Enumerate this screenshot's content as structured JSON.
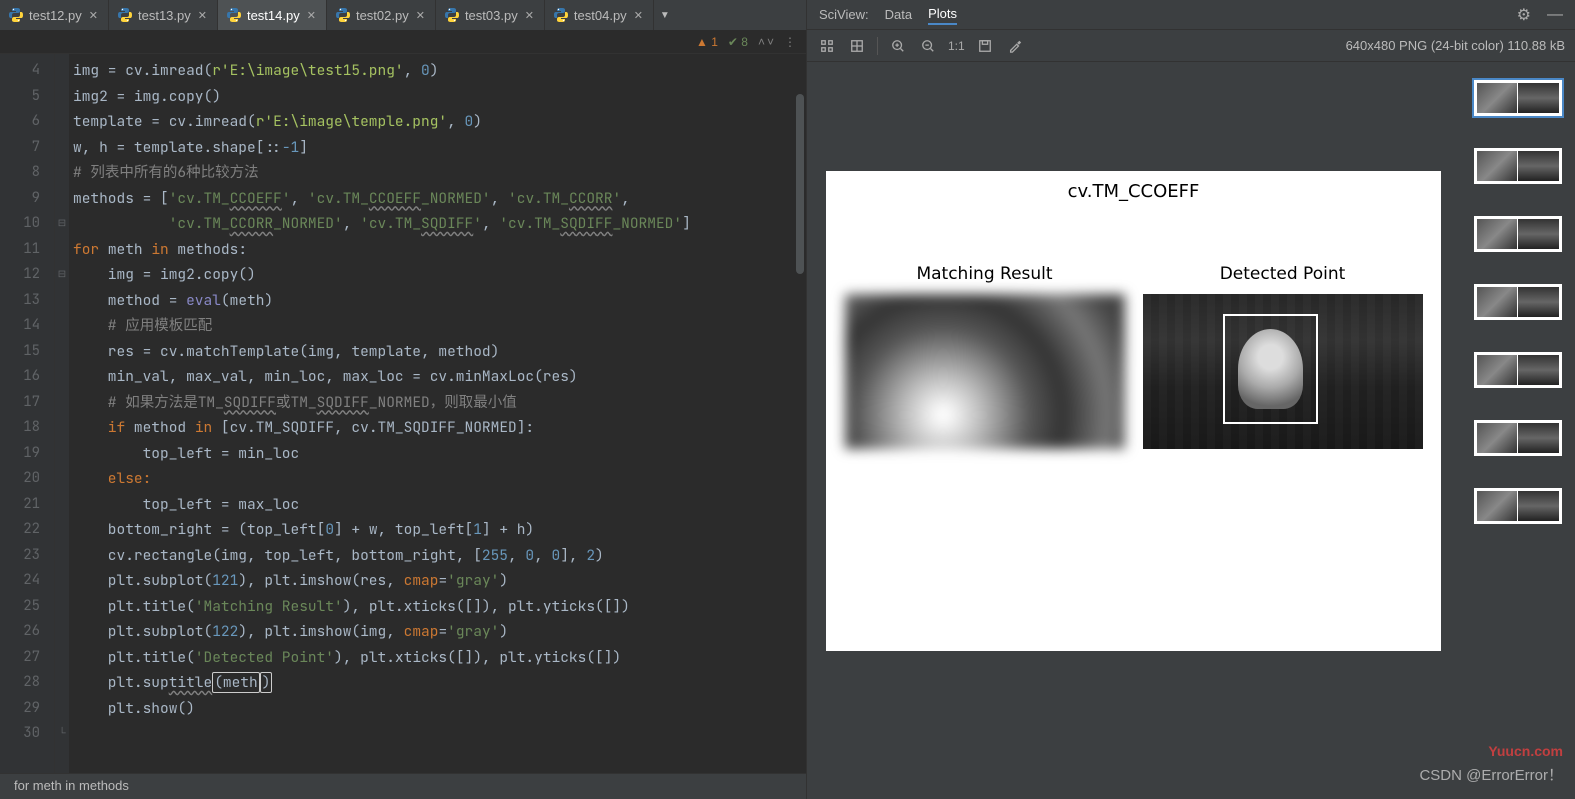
{
  "tabs": [
    {
      "name": "test12.py",
      "active": false
    },
    {
      "name": "test13.py",
      "active": false
    },
    {
      "name": "test14.py",
      "active": true
    },
    {
      "name": "test02.py",
      "active": false
    },
    {
      "name": "test03.py",
      "active": false
    },
    {
      "name": "test04.py",
      "active": false
    }
  ],
  "infobar": {
    "warn": "1",
    "check": "8"
  },
  "gutter": [
    "4",
    "5",
    "6",
    "7",
    "8",
    "9",
    "10",
    "11",
    "12",
    "13",
    "14",
    "15",
    "16",
    "17",
    "18",
    "19",
    "20",
    "21",
    "22",
    "23",
    "24",
    "25",
    "26",
    "27",
    "28",
    "29",
    "30"
  ],
  "code": {
    "l4": "",
    "l5a": "img = cv.imread(",
    "l5b": "r'E:\\image\\test15.png'",
    "l5c": ", ",
    "l5d": "0",
    "l5e": ")",
    "l6": "img2 = img.copy()",
    "l7a": "template = cv.imread(",
    "l7b": "r'E:\\image\\temple.png'",
    "l7c": ", ",
    "l7d": "0",
    "l7e": ")",
    "l8a": "w, h = template.shape[::",
    "l8b": "-1",
    "l8c": "]",
    "l9": "# 列表中所有的6种比较方法",
    "l10a": "methods = [",
    "l10b": "'cv.TM_",
    "l10c": "CCOEFF",
    "l10d": "'",
    "l10e": ", ",
    "l10f": "'cv.TM_",
    "l10g": "CCOEFF",
    "l10h": "_NORMED'",
    "l10i": ", ",
    "l10j": "'cv.TM_",
    "l10k": "CCORR",
    "l10l": "'",
    "l10m": ",",
    "l11a": "           ",
    "l11b": "'cv.TM_",
    "l11c": "CCORR",
    "l11d": "_NORMED'",
    "l11e": ", ",
    "l11f": "'cv.TM_",
    "l11g": "SQDIFF",
    "l11h": "'",
    "l11i": ", ",
    "l11j": "'cv.TM_",
    "l11k": "SQDIFF",
    "l11l": "_NORMED'",
    "l11m": "]",
    "l12a": "for ",
    "l12b": "meth ",
    "l12c": "in ",
    "l12d": "methods:",
    "l13": "    img = img2.copy()",
    "l14a": "    method = ",
    "l14b": "eval",
    "l14c": "(meth)",
    "l15": "    # 应用模板匹配",
    "l16": "    res = cv.matchTemplate(img, template, method)",
    "l17": "    min_val, max_val, min_loc, max_loc = cv.minMaxLoc(res)",
    "l18a": "    # 如果方法是TM_",
    "l18b": "SQDIFF",
    "l18c": "或TM_",
    "l18d": "SQDIFF",
    "l18e": "_NORMED，则取最小值",
    "l19a": "    if ",
    "l19b": "method ",
    "l19c": "in ",
    "l19d": "[cv.TM_SQDIFF, cv.TM_SQDIFF_NORMED]:",
    "l20": "        top_left = min_loc",
    "l21": "    else:",
    "l22": "        top_left = max_loc",
    "l23a": "    bottom_right = (top_left[",
    "l23b": "0",
    "l23c": "] + w, top_left[",
    "l23d": "1",
    "l23e": "] + h)",
    "l24a": "    cv.rectangle(img, top_left, bottom_right, [",
    "l24b": "255",
    "l24c": ", ",
    "l24d": "0",
    "l24e": ", ",
    "l24f": "0",
    "l24g": "], ",
    "l24h": "2",
    "l24i": ")",
    "l25a": "    plt.subplot(",
    "l25b": "121",
    "l25c": "), plt.imshow(res, ",
    "l25d": "cmap",
    "l25e": "=",
    "l25f": "'gray'",
    "l25g": ")",
    "l26a": "    plt.title(",
    "l26b": "'Matching Result'",
    "l26c": "), plt.xticks([]), plt.yticks([])",
    "l27a": "    plt.subplot(",
    "l27b": "122",
    "l27c": "), plt.imshow(img, ",
    "l27d": "cmap",
    "l27e": "=",
    "l27f": "'gray'",
    "l27g": ")",
    "l28a": "    plt.title(",
    "l28b": "'Detected Point'",
    "l28c": "), plt.xticks([]), plt.yticks([])",
    "l29a": "    plt.sup",
    "l29b": "title",
    "l29c": "(meth",
    "l30": "    plt.show()"
  },
  "breadcrumb": "for meth in methods",
  "sciview": {
    "label": "SciView:",
    "data": "Data",
    "plots": "Plots"
  },
  "toolbar": {
    "onetoone": "1:1",
    "info": "640x480 PNG (24-bit color) 110.88 kB"
  },
  "plot": {
    "suptitle": "cv.TM_CCOEFF",
    "sub1": "Matching Result",
    "sub2": "Detected Point"
  },
  "watermark1": "Yuucn.com",
  "watermark2": "CSDN @ErrorError！"
}
